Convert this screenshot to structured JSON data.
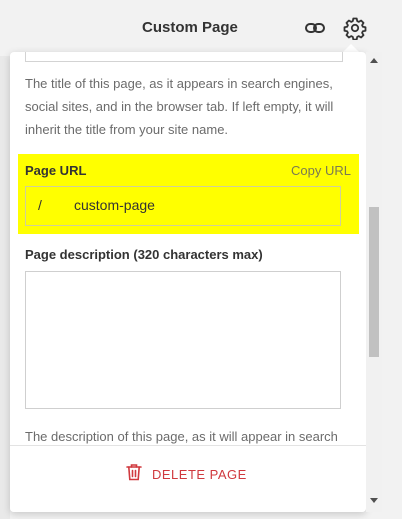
{
  "header": {
    "title": "Custom Page"
  },
  "panel": {
    "title_help": "The title of this page, as it appears in search engines, social sites, and in the browser tab. If left empty, it will inherit the title from your site name.",
    "page_url": {
      "label": "Page URL",
      "copy_label": "Copy URL",
      "prefix": "/",
      "value": "custom-page",
      "highlight_color": "#ffff00"
    },
    "description": {
      "label": "Page description (320 characters max)",
      "value": "",
      "help": "The description of this page, as it will appear in search"
    },
    "footer": {
      "delete_label": "DELETE PAGE",
      "delete_color": "#d0393e"
    }
  },
  "icons": [
    "link-icon",
    "gear-icon",
    "trash-icon"
  ]
}
